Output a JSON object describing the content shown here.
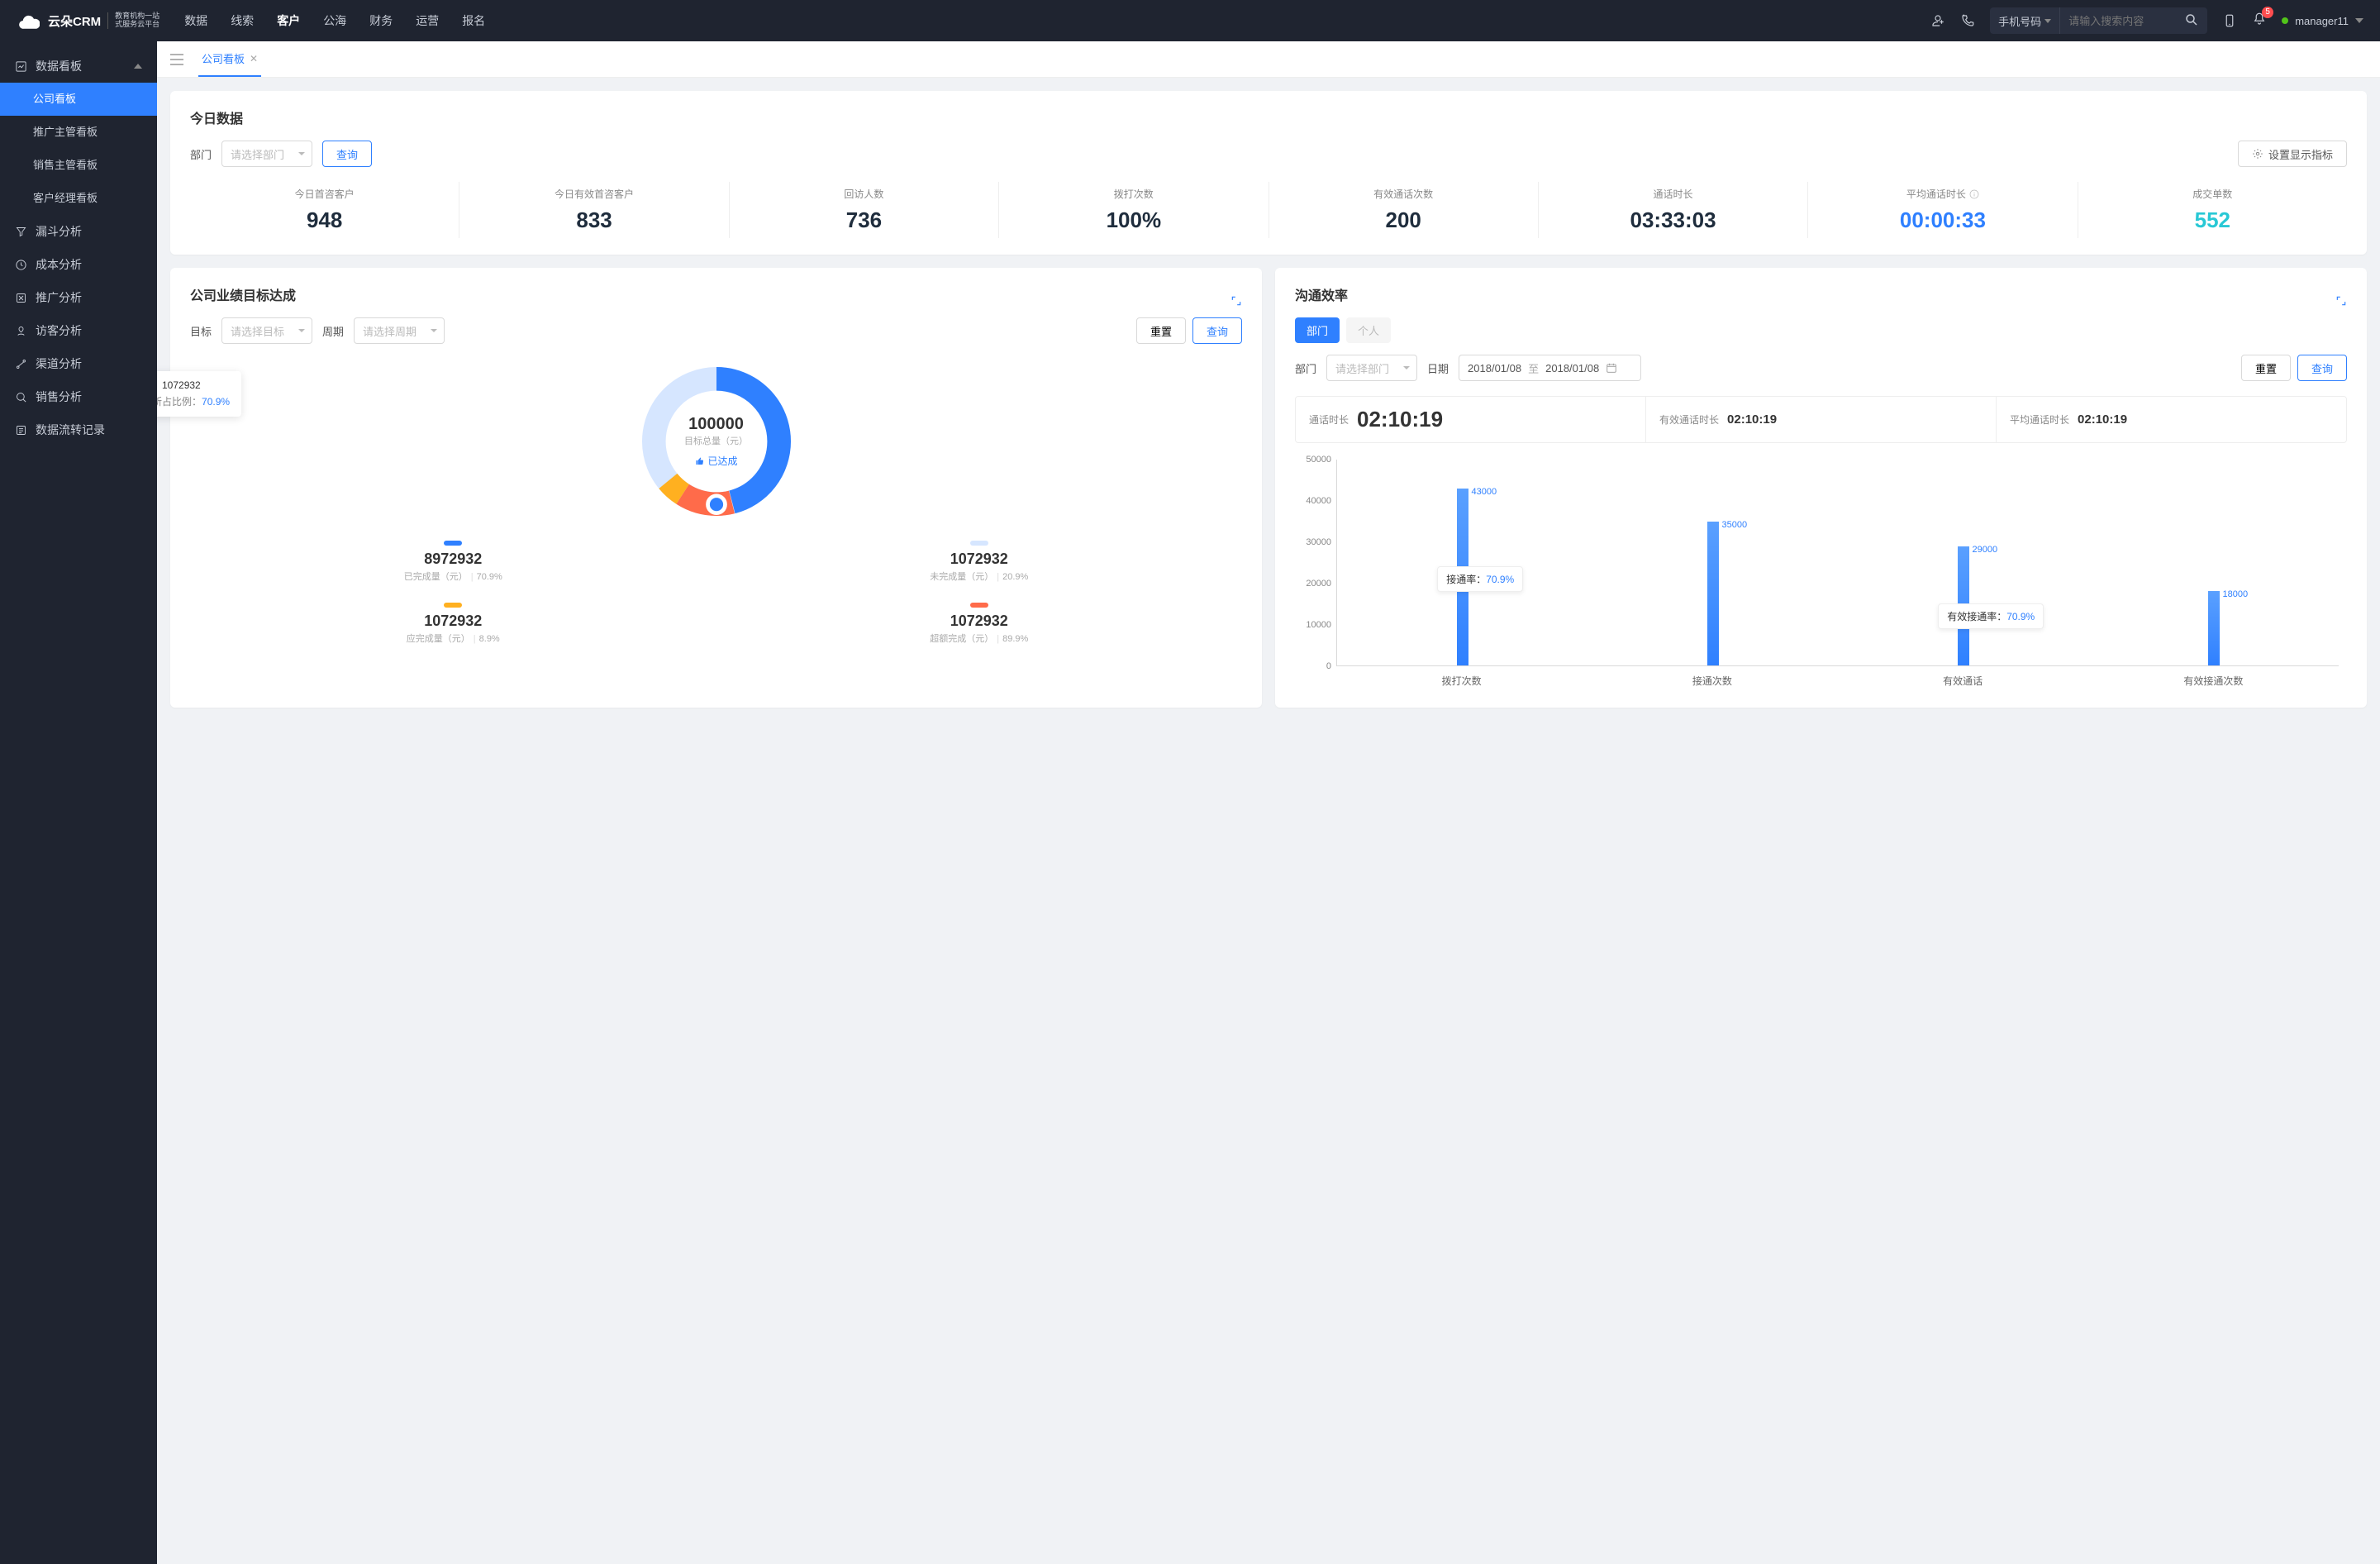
{
  "header": {
    "logo_brand": "云朵CRM",
    "logo_sub1": "教育机构一站",
    "logo_sub2": "式服务云平台",
    "nav": [
      "数据",
      "线索",
      "客户",
      "公海",
      "财务",
      "运营",
      "报名"
    ],
    "nav_active_index": 2,
    "search_type": "手机号码",
    "search_placeholder": "请输入搜索内容",
    "notification_badge": "5",
    "user_name": "manager11"
  },
  "sidebar": {
    "group_title": "数据看板",
    "subs": [
      "公司看板",
      "推广主管看板",
      "销售主管看板",
      "客户经理看板"
    ],
    "sub_active_index": 0,
    "items": [
      {
        "label": "漏斗分析"
      },
      {
        "label": "成本分析"
      },
      {
        "label": "推广分析"
      },
      {
        "label": "访客分析"
      },
      {
        "label": "渠道分析"
      },
      {
        "label": "销售分析"
      },
      {
        "label": "数据流转记录"
      }
    ]
  },
  "tabs": {
    "active": "公司看板"
  },
  "today": {
    "title": "今日数据",
    "dept_label": "部门",
    "dept_placeholder": "请选择部门",
    "query_btn": "查询",
    "settings_btn": "设置显示指标",
    "kpis": [
      {
        "label": "今日首咨客户",
        "value": "948",
        "color": ""
      },
      {
        "label": "今日有效首咨客户",
        "value": "833",
        "color": ""
      },
      {
        "label": "回访人数",
        "value": "736",
        "color": ""
      },
      {
        "label": "拨打次数",
        "value": "100%",
        "color": ""
      },
      {
        "label": "有效通话次数",
        "value": "200",
        "color": ""
      },
      {
        "label": "通话时长",
        "value": "03:33:03",
        "color": ""
      },
      {
        "label": "平均通话时长",
        "value": "00:00:33",
        "color": "blue",
        "info": true
      },
      {
        "label": "成交单数",
        "value": "552",
        "color": "teal"
      }
    ]
  },
  "goal": {
    "title": "公司业绩目标达成",
    "target_label": "目标",
    "target_placeholder": "请选择目标",
    "period_label": "周期",
    "period_placeholder": "请选择周期",
    "reset_btn": "重置",
    "query_btn": "查询",
    "donut": {
      "center_value": "100000",
      "center_sub": "目标总量（元）",
      "achieved_label": "已达成",
      "tooltip_value": "1072932",
      "tooltip_ratio_label": "所占比例：",
      "tooltip_ratio_value": "70.9%"
    },
    "legend": [
      {
        "color": "#2f80ff",
        "value": "8972932",
        "label": "已完成量（元）",
        "pct": "70.9%"
      },
      {
        "color": "#d6e6ff",
        "value": "1072932",
        "label": "未完成量（元）",
        "pct": "20.9%"
      },
      {
        "color": "#ffb020",
        "value": "1072932",
        "label": "应完成量（元）",
        "pct": "8.9%"
      },
      {
        "color": "#ff6b4a",
        "value": "1072932",
        "label": "超额完成（元）",
        "pct": "89.9%"
      }
    ]
  },
  "comm": {
    "title": "沟通效率",
    "tab_dept": "部门",
    "tab_person": "个人",
    "dept_label": "部门",
    "dept_placeholder": "请选择部门",
    "date_label": "日期",
    "date_from": "2018/01/08",
    "date_sep": "至",
    "date_to": "2018/01/08",
    "reset_btn": "重置",
    "query_btn": "查询",
    "stats": [
      {
        "label": "通话时长",
        "value": "02:10:19",
        "big": true
      },
      {
        "label": "有效通话时长",
        "value": "02:10:19"
      },
      {
        "label": "平均通话时长",
        "value": "02:10:19"
      }
    ],
    "annotations": [
      {
        "label": "接通率：",
        "value": "70.9%"
      },
      {
        "label": "有效接通率：",
        "value": "70.9%"
      }
    ]
  },
  "chart_data": {
    "type": "bar",
    "categories": [
      "拨打次数",
      "接通次数",
      "有效通话",
      "有效接通次数"
    ],
    "values": [
      43000,
      35000,
      29000,
      18000
    ],
    "ylabel": "",
    "xlabel": "",
    "ylim": [
      0,
      50000
    ],
    "yticks": [
      0,
      10000,
      20000,
      30000,
      40000,
      50000
    ]
  }
}
